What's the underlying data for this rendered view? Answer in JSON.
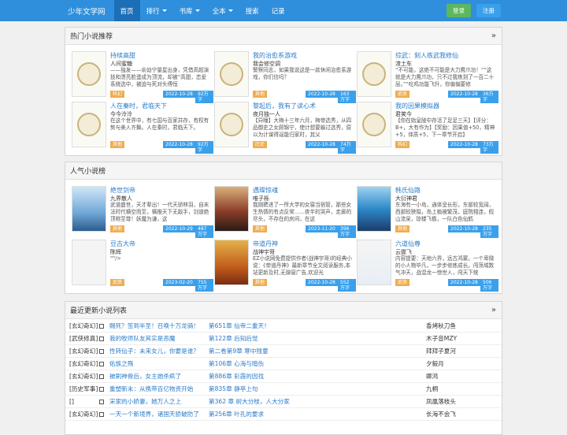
{
  "nav": {
    "brand": "少年文学网",
    "items": [
      {
        "label": "首页",
        "active": true,
        "caret": false
      },
      {
        "label": "排行",
        "active": false,
        "caret": true
      },
      {
        "label": "书库",
        "active": false,
        "caret": true
      },
      {
        "label": "全本",
        "active": false,
        "caret": true
      },
      {
        "label": "搜索",
        "active": false,
        "caret": false
      },
      {
        "label": "记录",
        "active": false,
        "caret": false
      }
    ],
    "login_label": "登录",
    "register_label": "注册"
  },
  "hot": {
    "title": "热门小说推荐",
    "cards": [
      {
        "title": "持续高甜",
        "author": "人间蜜糖",
        "desc": "——独发——俞幼宁量星出身，凭借高超演技和漂亮脸蛋成为顶流，却被“高甜，恋爱系统选中，被迫与死对头傅恒",
        "tag": "科幻",
        "date": "2022-10-28",
        "size": "92万字"
      },
      {
        "title": "我的治愈系游戏",
        "author": "我会修空调",
        "desc": "警察同志，如果我说这是一款休闲治愈系游戏，你们信吗？",
        "tag": "其他",
        "date": "2022-10-28",
        "size": "163万字"
      },
      {
        "title": "综武：刻人练武我修仙",
        "author": "渣土车",
        "desc": "“不可能，这绝不可能是大力鹰爪功！”“这就是大力鹰爪功，只不过我练到了一百二十层。”“吃鸡功能飞升，你偏偏要修",
        "tag": "武侠",
        "date": "2022-10-28",
        "size": "36万字"
      },
      {
        "title": "人在秦时，君临天下",
        "author": "今今泠泠",
        "desc": "在这个世界中，有七国与百家并存，有权有势与美人齐舞。人在秦时，君临天下。",
        "tag": "其他",
        "date": "2022-10-28",
        "size": "92万字"
      },
      {
        "title": "黎起后，我有了读心术",
        "author": "夜月独一人",
        "desc": "【异瞳】大梅十三年六月，梅帝选秀，从四品御史之女顾锦宁，使计想要躲过选秀，原以为计谋得逞能归家时，其父",
        "tag": "历史",
        "date": "2022-10-28",
        "size": "74万字"
      },
      {
        "title": "我的因果模拟器",
        "author": "君笑今",
        "desc": "【你在始皇陵中存活了足足三天】【评分：B+，大有作为】【奖励：因果值+50，精神+5，体质+5，下一章节开启】",
        "tag": "科幻",
        "date": "2022-10-28",
        "size": "73万字"
      }
    ]
  },
  "popular": {
    "title": "人气小说榜",
    "cards": [
      {
        "title": "绝世剑帝",
        "author": "九界散人",
        "desc": "武道盛世，天才辈出！一代天骄林羽，自末法时代横空而至，横推天下无敌手，剑道绝顶称至尊！妖魔为谦，这",
        "tag": "其他",
        "date": "2022-10-29",
        "size": "487万字",
        "cover": "pc1"
      },
      {
        "title": "遇璨惊魂",
        "author": "唯子栎",
        "desc": "我刚聘进了一所大学的女寝当宿管，那些女生热情的有点反常……夜半的哭声，走廊的尽头，不存在的房间，在这",
        "tag": "其他",
        "date": "2023-11-20",
        "size": "396万字",
        "cover": "pc2"
      },
      {
        "title": "韩氏仙路",
        "author": "大衍神君",
        "desc": "东海有一小岛，通体呈长形，东部较宽阔，西部较狭隘，岛上植被繁茂，庭院相连，假山流泉，琼楼飞檐，一队白色仙鹤",
        "tag": "其他",
        "date": "2022-10-28",
        "size": "235万字",
        "cover": "pc3"
      },
      {
        "title": "豆古大帝",
        "author": "陈辉",
        "desc": "\"\"/>",
        "tag": "武侠",
        "date": "2023-02-20",
        "size": "755万字",
        "cover": "pc4"
      },
      {
        "title": "帝道丹神",
        "author": "战神宇哥",
        "desc": "EZ小说网免费提供作者(战神宇哥)的经典小说：《帝道丹神》最新章节全文阅读服务,本站更新及时,无弹窗广告,欢迎光",
        "tag": "其他",
        "date": "2022-10-28",
        "size": "552万字",
        "cover": "pc5"
      },
      {
        "title": "六道仙尊",
        "author": "云霆飞",
        "desc": "内容提要：天地六界，远古鸿蒙。一个卑微的小人物毕凡，一步步修炼成长。闯荡域数气冲天，战混龙一惊世人，闯天下统",
        "tag": "武侠",
        "date": "2022-10-28",
        "size": "506万字",
        "cover": "pc6"
      }
    ]
  },
  "latest": {
    "title": "最近更新小说列表",
    "rows": [
      {
        "cat": "[玄幻奇幻]",
        "book": "赐死？签到半圣！召唤十万龙骑！",
        "chapter": "第651章 仙帝二重天！",
        "author": "香烤秋刀鱼"
      },
      {
        "cat": "[武侠修真]",
        "book": "我的牧师队友其实是恶魔",
        "chapter": "第122章 后知后觉",
        "author": "木子音MZY"
      },
      {
        "cat": "[玄幻奇幻]",
        "book": "性转仙子：未来女儿，你要是谁？",
        "chapter": "第二卷第9章 寒中残童",
        "author": "拜拜子夏河"
      },
      {
        "cat": "[玄幻奇幻]",
        "book": "佑族之殇",
        "chapter": "第106章 心海与暗伤",
        "author": "夕毅月"
      },
      {
        "cat": "[玄幻奇幻]",
        "book": "被刷神骨后，女主她杀疯了",
        "chapter": "第886章 彩霞的因找",
        "author": "卿鸿"
      },
      {
        "cat": "[历史军事]",
        "book": "重塑新末：从携带百亿物资开始",
        "chapter": "第835章 静亭上句",
        "author": "九桐"
      },
      {
        "cat": "[]",
        "book": "宋家的小娇妻，她万人之上",
        "chapter": "第362 章 树大分枝，人大分家",
        "author": "凤凰落枝头"
      },
      {
        "cat": "[玄幻奇幻]",
        "book": "一天一个新境界，诸国天骄破防了",
        "chapter": "第256章 叶孔的要求",
        "author": "长海不会飞"
      }
    ]
  }
}
